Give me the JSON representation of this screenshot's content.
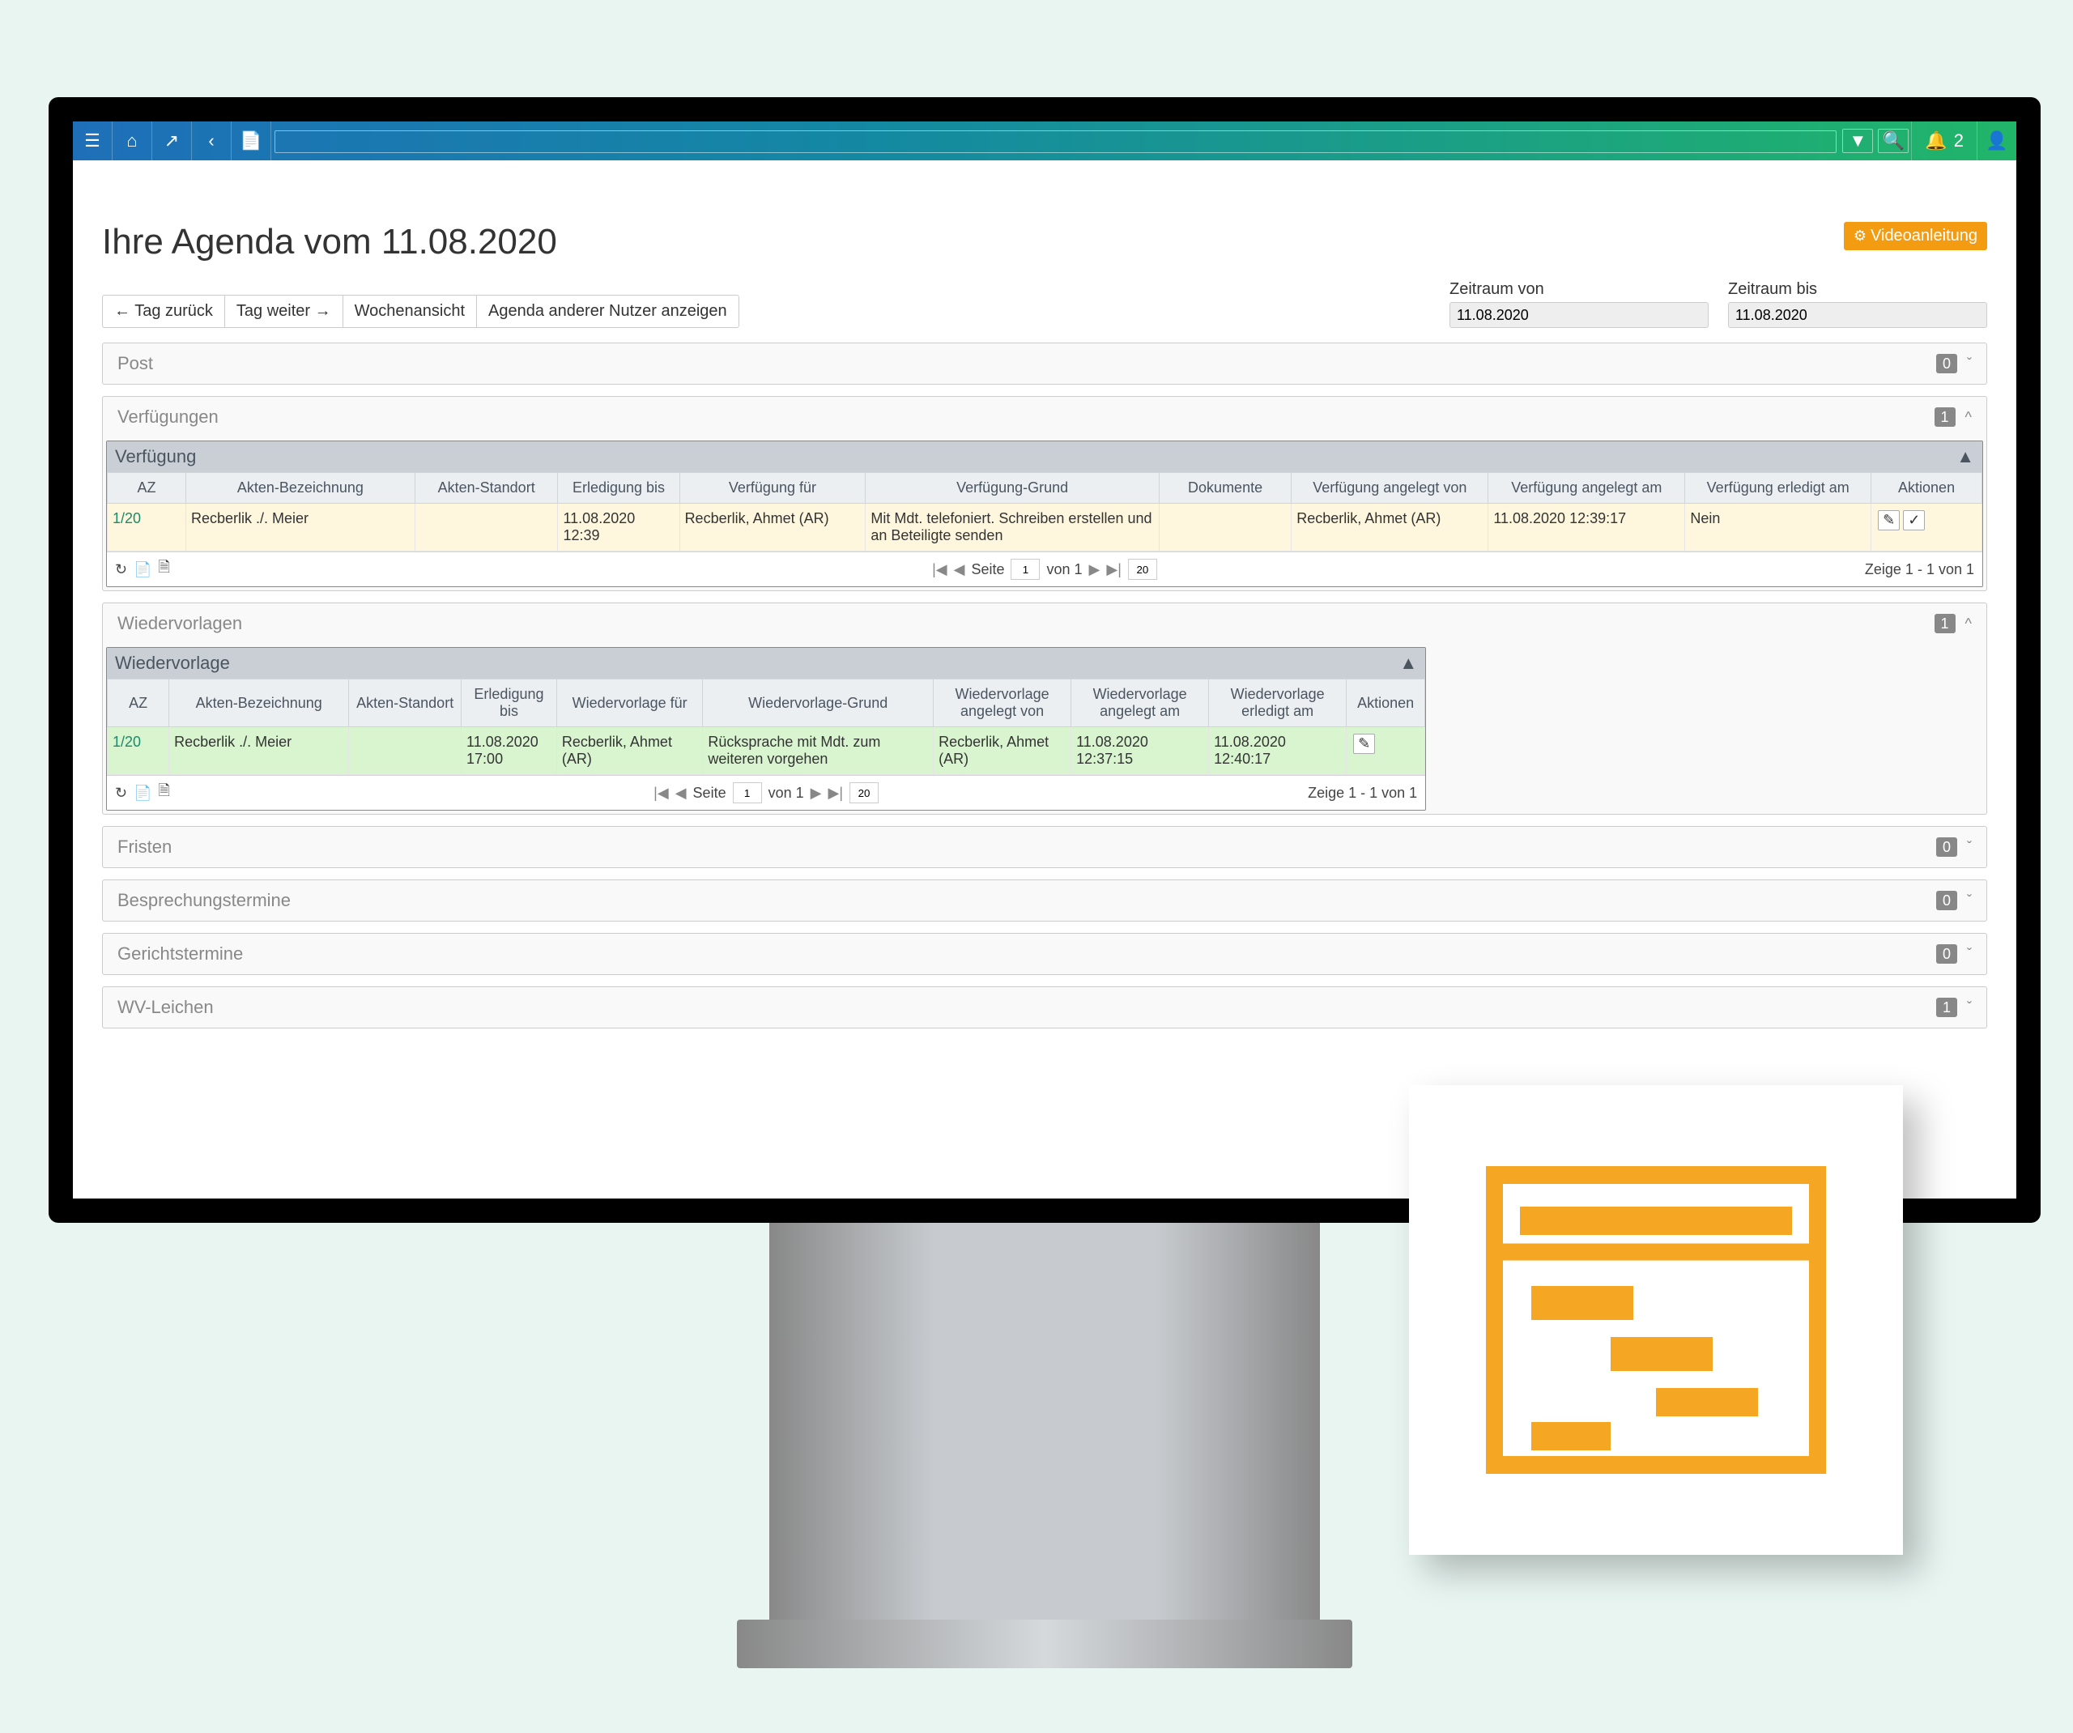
{
  "topbar": {
    "notification_count": "2"
  },
  "page": {
    "title": "Ihre Agenda vom 11.08.2020",
    "video_btn": "Videoanleitung"
  },
  "controls": {
    "day_back": "Tag zurück",
    "day_fwd": "Tag weiter",
    "week_view": "Wochenansicht",
    "other_user": "Agenda anderer Nutzer anzeigen",
    "range_from_label": "Zeitraum von",
    "range_to_label": "Zeitraum bis",
    "range_from": "11.08.2020",
    "range_to": "11.08.2020"
  },
  "panels": {
    "post": {
      "title": "Post",
      "count": "0"
    },
    "verf": {
      "title": "Verfügungen",
      "count": "1"
    },
    "wv": {
      "title": "Wiedervorlagen",
      "count": "1"
    },
    "fristen": {
      "title": "Fristen",
      "count": "0"
    },
    "besprech": {
      "title": "Besprechungstermine",
      "count": "0"
    },
    "gericht": {
      "title": "Gerichtstermine",
      "count": "0"
    },
    "wvleichen": {
      "title": "WV-Leichen",
      "count": "1"
    }
  },
  "verf_grid": {
    "title": "Verfügung",
    "headers": {
      "az": "AZ",
      "bez": "Akten-Bezeichnung",
      "stand": "Akten-Standort",
      "erl": "Erledigung bis",
      "fuer": "Verfügung für",
      "grund": "Verfügung-Grund",
      "dok": "Dokumente",
      "von": "Verfügung angelegt von",
      "am": "Verfügung angelegt am",
      "erlam": "Verfügung erledigt am",
      "akt": "Aktionen"
    },
    "row": {
      "az": "1/20",
      "bez": "Recberlik ./. Meier",
      "stand": "",
      "erl": "11.08.2020 12:39",
      "fuer": "Recberlik, Ahmet (AR)",
      "grund": "Mit Mdt. telefoniert. Schreiben erstellen und an Beteiligte senden",
      "dok": "",
      "von": "Recberlik, Ahmet (AR)",
      "am": "11.08.2020 12:39:17",
      "erlam": "Nein"
    },
    "pager": {
      "seite": "Seite",
      "page": "1",
      "von": "von 1",
      "per": "20",
      "range": "Zeige 1 - 1 von 1"
    }
  },
  "wv_grid": {
    "title": "Wiedervorlage",
    "headers": {
      "az": "AZ",
      "bez": "Akten-Bezeichnung",
      "stand": "Akten-Standort",
      "erl": "Erledigung bis",
      "fuer": "Wiedervorlage für",
      "grund": "Wiedervorlage-Grund",
      "von": "Wiedervorlage angelegt von",
      "am": "Wiedervorlage angelegt am",
      "erlam": "Wiedervorlage erledigt am",
      "akt": "Aktionen"
    },
    "row": {
      "az": "1/20",
      "bez": "Recberlik ./. Meier",
      "stand": "",
      "erl": "11.08.2020 17:00",
      "fuer": "Recberlik, Ahmet (AR)",
      "grund": "Rücksprache mit Mdt. zum weiteren vorgehen",
      "von": "Recberlik, Ahmet (AR)",
      "am": "11.08.2020 12:37:15",
      "erlam": "11.08.2020 12:40:17"
    },
    "pager": {
      "seite": "Seite",
      "page": "1",
      "von": "von 1",
      "per": "20",
      "range": "Zeige 1 - 1 von 1"
    }
  }
}
